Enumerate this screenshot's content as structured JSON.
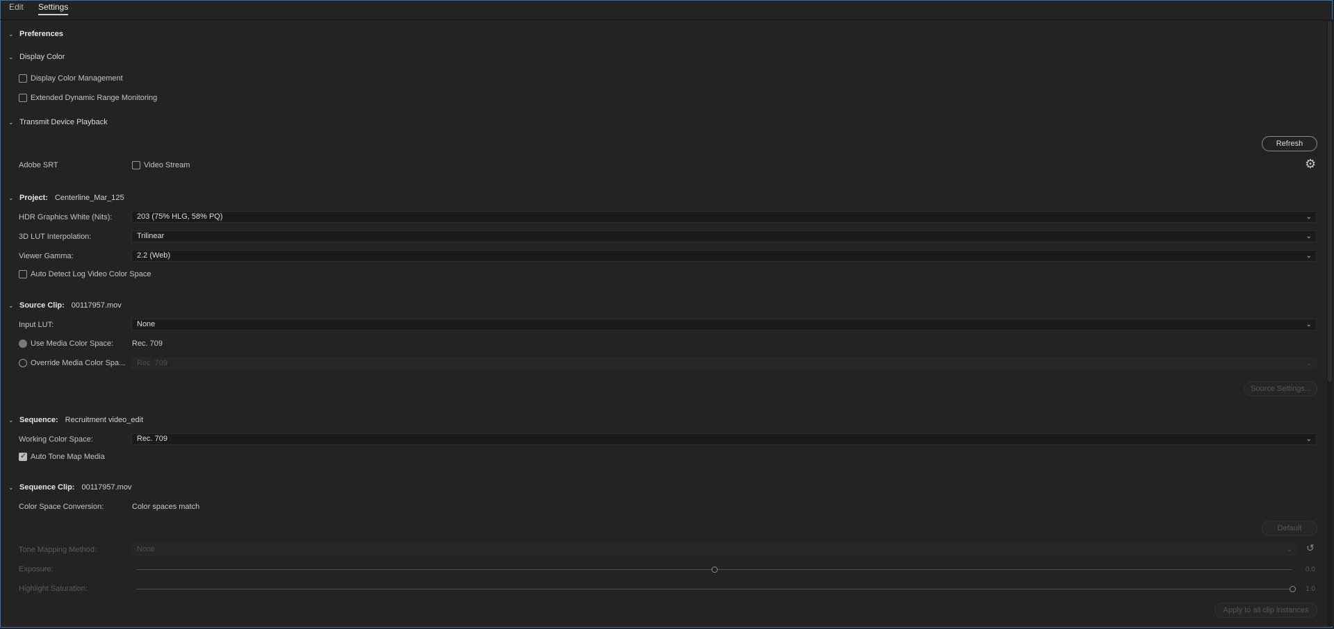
{
  "tabs": [
    {
      "label": "Edit"
    },
    {
      "label": "Settings"
    }
  ],
  "sections": {
    "preferences": {
      "title": "Preferences"
    },
    "display_color": {
      "title": "Display Color",
      "display_color_management": "Display Color Management",
      "extended_dynamic_range": "Extended Dynamic Range Monitoring"
    },
    "transmit": {
      "title": "Transmit Device Playback",
      "refresh": "Refresh",
      "adobe_srt": "Adobe SRT",
      "video_stream": "Video Stream",
      "settings_icon": "gear-icon"
    },
    "project": {
      "title": "Project:",
      "name": "Centerline_Mar_125",
      "hdr_label": "HDR Graphics White (Nits):",
      "hdr_value": "203 (75% HLG, 58% PQ)",
      "lut_label": "3D LUT Interpolation:",
      "lut_value": "Trilinear",
      "gamma_label": "Viewer Gamma:",
      "gamma_value": "2.2 (Web)",
      "auto_detect": "Auto Detect Log Video Color Space"
    },
    "source_clip": {
      "title": "Source Clip:",
      "name": "00117957.mov",
      "input_lut_label": "Input LUT:",
      "input_lut_value": "None",
      "use_media_label": "Use Media Color Space:",
      "use_media_value": "Rec. 709",
      "override_label": "Override Media Color Spa...",
      "override_value": "Rec. 709",
      "source_settings": "Source Settings..."
    },
    "sequence": {
      "title": "Sequence:",
      "name": "Recruitment video_edit",
      "working_label": "Working Color Space:",
      "working_value": "Rec. 709",
      "auto_tone": "Auto Tone Map Media"
    },
    "sequence_clip": {
      "title": "Sequence Clip:",
      "name": "00117957.mov",
      "conversion_label": "Color Space Conversion:",
      "conversion_value": "Color spaces match",
      "default_btn": "Default",
      "tone_label": "Tone Mapping Method:",
      "tone_value": "None",
      "exposure_label": "Exposure:",
      "exposure_value": "0.0",
      "exposure_level": 0.5,
      "highlight_label": "Highlight Saturation:",
      "highlight_value": "1.0",
      "highlight_level": 1.0,
      "apply_btn": "Apply to all clip instances"
    }
  }
}
